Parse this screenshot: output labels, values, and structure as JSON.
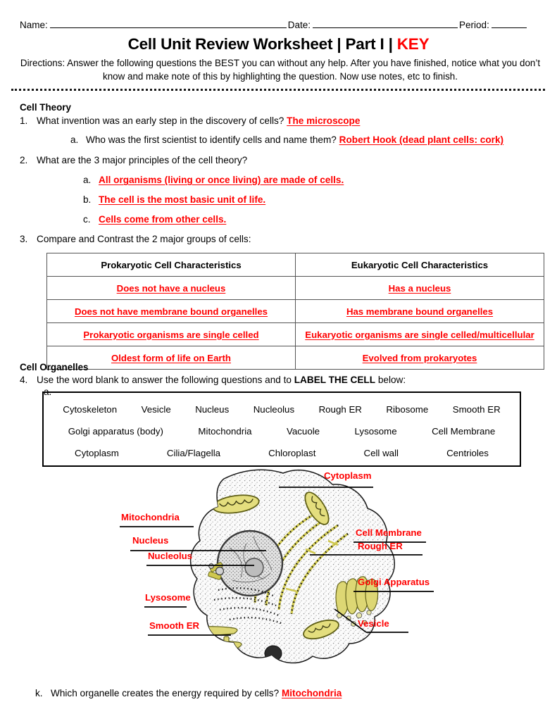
{
  "header": {
    "name_label": "Name:",
    "date_label": "Date:",
    "period_label": "Period:"
  },
  "title": {
    "main": "Cell Unit Review Worksheet | Part I | ",
    "key": "KEY"
  },
  "directions": {
    "text": "Directions: Answer the following questions the BEST you can without any help.  After you have finished, notice what you don’t know and make note of this by highlighting the question.  Now use notes, etc to finish."
  },
  "sections": {
    "cell_theory_heading": "Cell Theory",
    "cell_organelles_heading": "Cell Organelles"
  },
  "questions": {
    "q1_num": "1.",
    "q1_text": "What invention was an early step in the discovery of cells?",
    "q1_answer": "The microscope",
    "q1a_num": "a.",
    "q1a_text": "Who was the first scientist to identify cells and name them?",
    "q1a_answer": "Robert Hook (dead plant cells: cork)",
    "q2_num": "2.",
    "q2_text": "What are the 3 major principles of the cell theory?",
    "q2a_num": "a.",
    "q2a_answer": "All organisms (living or once living) are made of cells.",
    "q2b_num": "b.",
    "q2b_answer": "The cell is the most basic unit of life.",
    "q2c_num": "c.",
    "q2c_answer": "Cells come from other cells.",
    "q3_num": "3.",
    "q3_text": "Compare and Contrast the 2 major groups of cells:",
    "q4_num": "4.",
    "q4_text_pre": "Use the word blank to answer the following questions and to ",
    "q4_text_bold": "LABEL THE CELL",
    "q4_text_post": " below:",
    "q4a_num": "a.",
    "qk_num": "k.",
    "qk_text": "Which organelle creates the energy required by cells?",
    "qk_answer": "Mitochondria"
  },
  "comparison_table": {
    "headers": [
      "Prokaryotic Cell Characteristics",
      "Eukaryotic Cell Characteristics"
    ],
    "rows": [
      [
        "Does not have a  nucleus",
        "Has a nucleus"
      ],
      [
        "Does not have membrane bound organelles",
        "Has membrane bound organelles"
      ],
      [
        "Prokaryotic organisms are single celled",
        "Eukaryotic organisms are single celled/multicellular"
      ],
      [
        "Oldest form of life on Earth",
        "Evolved from prokaryotes"
      ]
    ]
  },
  "word_bank": {
    "row1": [
      "Cytoskeleton",
      "Vesicle",
      "Nucleus",
      "Nucleolus",
      "Rough ER",
      "Ribosome",
      "Smooth ER"
    ],
    "row2": [
      "Golgi apparatus (body)",
      "Mitochondria",
      "Vacuole",
      "Lysosome",
      "Cell Membrane"
    ],
    "row3": [
      "Cytoplasm",
      "Cilia/Flagella",
      "Chloroplast",
      "Cell wall",
      "Centrioles"
    ]
  },
  "diagram": {
    "labels": {
      "cytoplasm": "Cytoplasm",
      "mitochondria": "Mitochondria",
      "nucleus": "Nucleus",
      "nucleolus": "Nucleolus",
      "lysosome": "Lysosome",
      "smooth_er": "Smooth ER",
      "cell_membrane": "Cell Membrane",
      "rough_er": "Rough ER",
      "golgi_apparatus": "Golgi Apparatus",
      "vesicle": "Vesicle"
    }
  },
  "colors": {
    "answer_red": "#ff0000",
    "organelle_yellow": "#e8e36a",
    "cytoplasm_fill": "#fafafa",
    "table_border": "#555555"
  }
}
